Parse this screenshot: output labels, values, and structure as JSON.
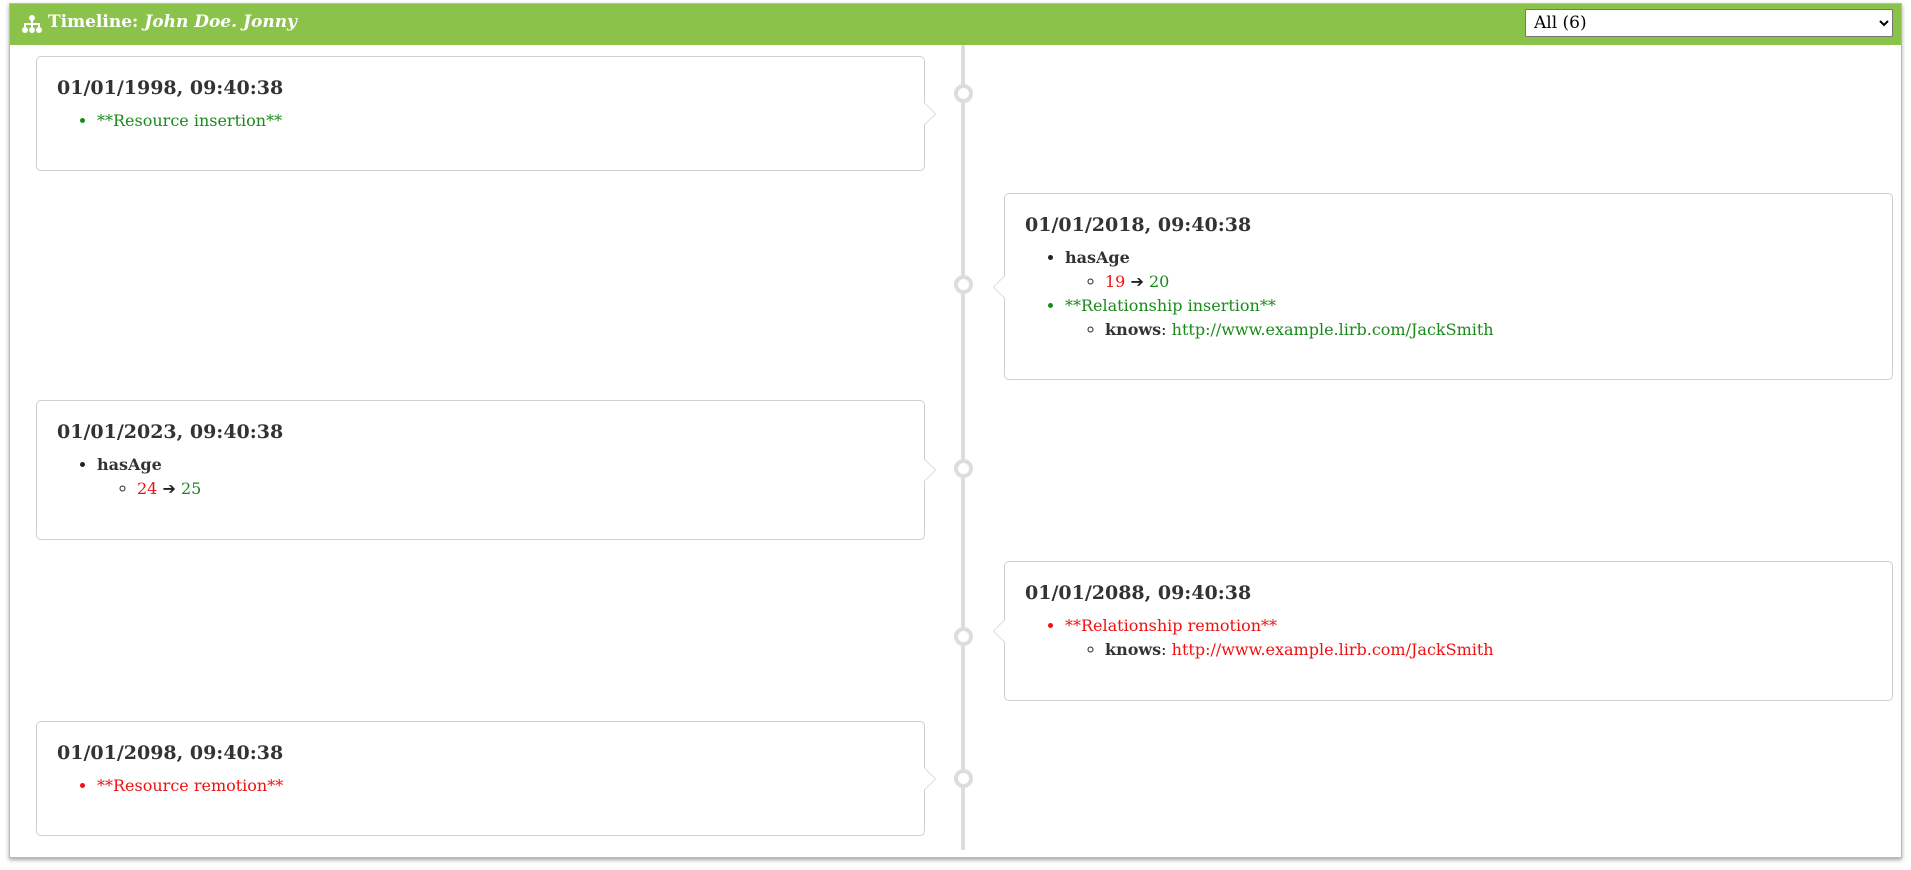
{
  "header": {
    "title_label": "Timeline:",
    "subject": "John Doe. Jonny",
    "filter_options": [
      "All (6)"
    ],
    "filter_selected": "All (6)"
  },
  "events": [
    {
      "date": "01/01/1998, 09:40:38",
      "insertion": "**Resource insertion**"
    },
    {
      "date": "01/01/2018, 09:40:38",
      "property": "hasAge",
      "old_value": "19",
      "arrow": "➔",
      "new_value": "20",
      "relationship_label": "**Relationship insertion**",
      "rel_property": "knows",
      "rel_separator": ":",
      "rel_target": "http://www.example.lirb.com/JackSmith"
    },
    {
      "date": "01/01/2023, 09:40:38",
      "property": "hasAge",
      "old_value": "24",
      "arrow": "➔",
      "new_value": "25"
    },
    {
      "date": "01/01/2088, 09:40:38",
      "relationship_label": "**Relationship remotion**",
      "rel_property": "knows",
      "rel_separator": ":",
      "rel_target": "http://www.example.lirb.com/JackSmith"
    },
    {
      "date": "01/01/2098, 09:40:38",
      "remotion": "**Resource remotion**"
    }
  ],
  "colors": {
    "header": "#8bc34a",
    "added": "#1a8a1a",
    "removed": "#ee1111",
    "timeline": "#dddddd"
  },
  "icons": {
    "title": "timeline-graph-icon"
  }
}
